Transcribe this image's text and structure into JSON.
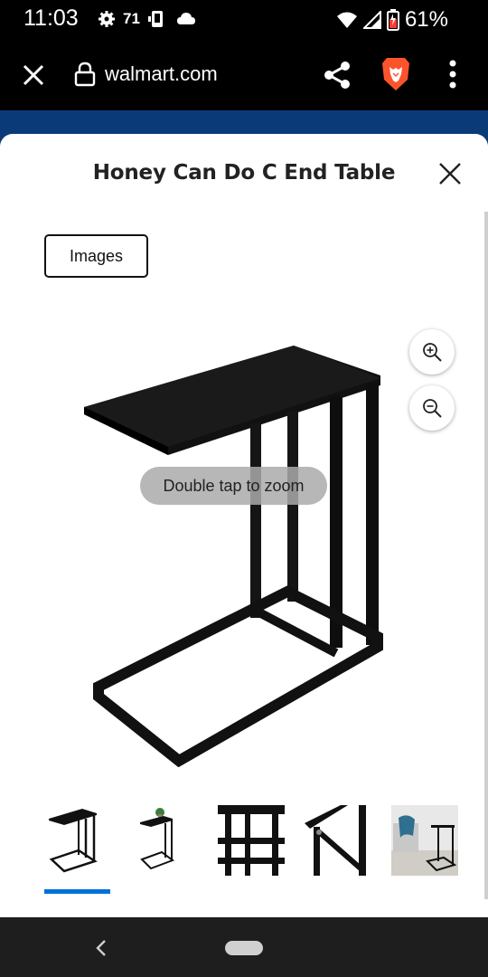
{
  "status_bar": {
    "time": "11:03",
    "temperature": "71",
    "battery": "61%",
    "icons": [
      "gear-icon",
      "phone-icon",
      "cloud-icon",
      "wifi-icon",
      "signal-icon",
      "battery-icon"
    ]
  },
  "browser": {
    "url": "walmart.com",
    "icons": [
      "close-icon",
      "lock-icon",
      "share-icon",
      "brave-lion-icon",
      "more-vert-icon"
    ],
    "accent": "#0a3a78"
  },
  "sheet": {
    "title": "Honey Can Do C End Table",
    "images_label": "Images",
    "zoom_hint": "Double tap to zoom",
    "zoom_in_icon": "zoom-in-icon",
    "zoom_out_icon": "zoom-out-icon",
    "thumbnails": [
      {
        "name": "thumbnail-1",
        "active": true
      },
      {
        "name": "thumbnail-2",
        "active": false
      },
      {
        "name": "thumbnail-3",
        "active": false
      },
      {
        "name": "thumbnail-4",
        "active": false
      },
      {
        "name": "thumbnail-5",
        "active": false
      }
    ],
    "active_color": "#0071dc"
  },
  "nav_bar": {
    "icons": [
      "back-icon",
      "home-pill-icon"
    ]
  }
}
